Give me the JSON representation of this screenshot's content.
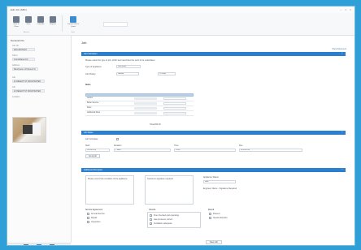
{
  "window": {
    "title": "Edit Job (ABC)",
    "controls": [
      "–",
      "□",
      "×"
    ]
  },
  "ribbon": {
    "buttons": [
      {
        "label": "Save & Close"
      },
      {
        "label": "Save"
      },
      {
        "label": "Calendar"
      },
      {
        "label": "Reports"
      },
      {
        "label": "Convert Job to Quote"
      }
    ],
    "search_placeholder": "",
    "groups": [
      "Actions",
      "Tools"
    ]
  },
  "sidebar": {
    "heading": "General Info",
    "fields": [
      {
        "label": "Job No.",
        "value": "ADS-AB-00123"
      },
      {
        "label": "Client",
        "value": "Consolidated Ltd"
      },
      {
        "label": "Address",
        "value": "Manchester, 22 Regent St"
      },
      {
        "label": "Job",
        "value": "22 REGENT ST MANCHESTER"
      },
      {
        "label": "Job",
        "value": "22 REGENT ST MANCHESTER"
      },
      {
        "label": "Location",
        "value": ""
      }
    ]
  },
  "main": {
    "title": "Job",
    "top_link": "Show Document",
    "sections": [
      {
        "title": "Job Information",
        "expanded": true
      },
      {
        "title": "Job Status",
        "expanded": true
      },
      {
        "title": "Additional Information",
        "expanded": true
      }
    ],
    "job_info": {
      "description": "Please select the type of job, which best describes the work to be undertaken.",
      "row1_label": "Type of Appliance",
      "row1_value": "Gas Boiler",
      "row2_label": "Job Priority",
      "row2_value": "Normal",
      "row2_extra": "10 Days",
      "table_title": "Items",
      "table_rows": [
        {
          "name": "Labour"
        },
        {
          "name": "Boiler Service"
        },
        {
          "name": "Parts"
        },
        {
          "name": "Additional Parts"
        }
      ],
      "total_label": "Total £50.00"
    },
    "job_status": {
      "status_label": "Job Complete",
      "columns": [
        "Start",
        "Duration",
        "Time",
        "Due"
      ],
      "values": [
        "01/03/2018",
        "1 Hour",
        "10:00",
        "01/03/2018"
      ],
      "button": "Go to job"
    },
    "additional": {
      "notes_label": "Please record the condition of the appliance",
      "notes2_label": "Customer signature required",
      "select_label": "Appliance Status",
      "select_value": "Safe",
      "signature_label": "Engineer Name - Signature Required",
      "group1_title": "Service Agreement",
      "group1_items": [
        "Annual Service",
        "Repair",
        "Inspection"
      ],
      "group2_title": "Checks",
      "group2_items": [
        "Flue checked and operating",
        "Gas pressure correct",
        "Ventilation adequate"
      ],
      "group3_title": "Result",
      "group3_items": [
        "Passed",
        "Needs Attention"
      ],
      "save_button": "Save Job"
    }
  },
  "colors": {
    "accent": "#2a7fcf",
    "background": "#2f9fd8",
    "table_header": "#b7cfe8"
  }
}
